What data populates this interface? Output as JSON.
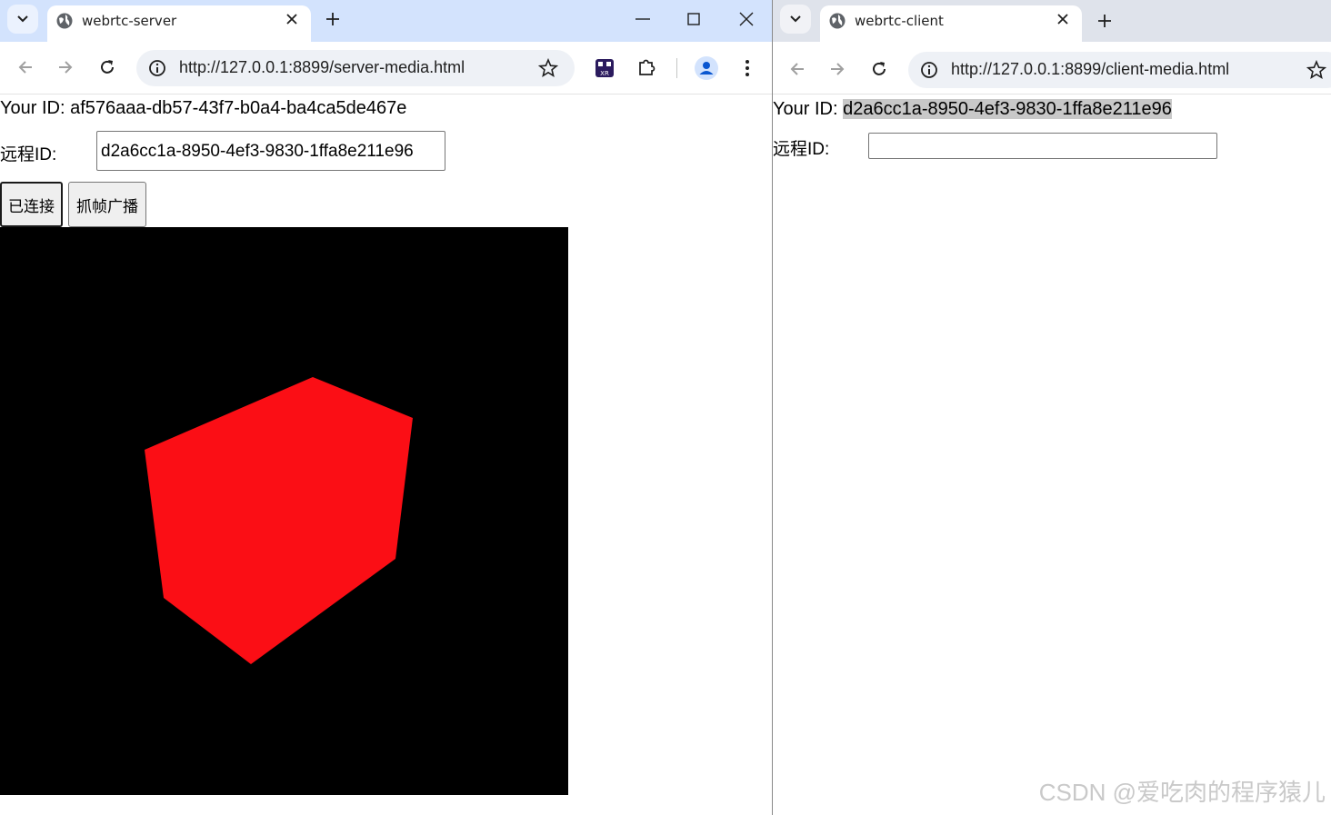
{
  "server_window": {
    "tab_title": "webrtc-server",
    "url": "http://127.0.0.1:8899/server-media.html",
    "your_id_label": "Your ID:",
    "your_id_value": "af576aaa-db57-43f7-b0a4-ba4ca5de467e",
    "remote_id_label": "远程ID:",
    "remote_id_value": "d2a6cc1a-8950-4ef3-9830-1ffa8e211e96",
    "connect_button": "已连接",
    "broadcast_button": "抓帧广播",
    "cube_color": "#fb0e15",
    "canvas_background": "#000000"
  },
  "client_window": {
    "tab_title": "webrtc-client",
    "url": "http://127.0.0.1:8899/client-media.html",
    "your_id_label": "Your ID:",
    "your_id_value": "d2a6cc1a-8950-4ef3-9830-1ffa8e211e96",
    "remote_id_label": "远程ID:",
    "remote_id_value": ""
  },
  "watermark": "CSDN @爱吃肉的程序猿儿",
  "icons": [
    "tab-search-icon",
    "globe-icon",
    "close-icon",
    "plus-icon",
    "minimize-icon",
    "maximize-icon",
    "back-icon",
    "forward-icon",
    "reload-icon",
    "info-icon",
    "star-icon",
    "xr-extension-icon",
    "extensions-puzzle-icon",
    "profile-icon",
    "menu-icon"
  ],
  "colors": {
    "tabstrip_active": "#d3e3fd",
    "tabstrip_inactive": "#dfe3eb",
    "omnibox": "#eef1f6",
    "profile_blue": "#0b57d0"
  }
}
